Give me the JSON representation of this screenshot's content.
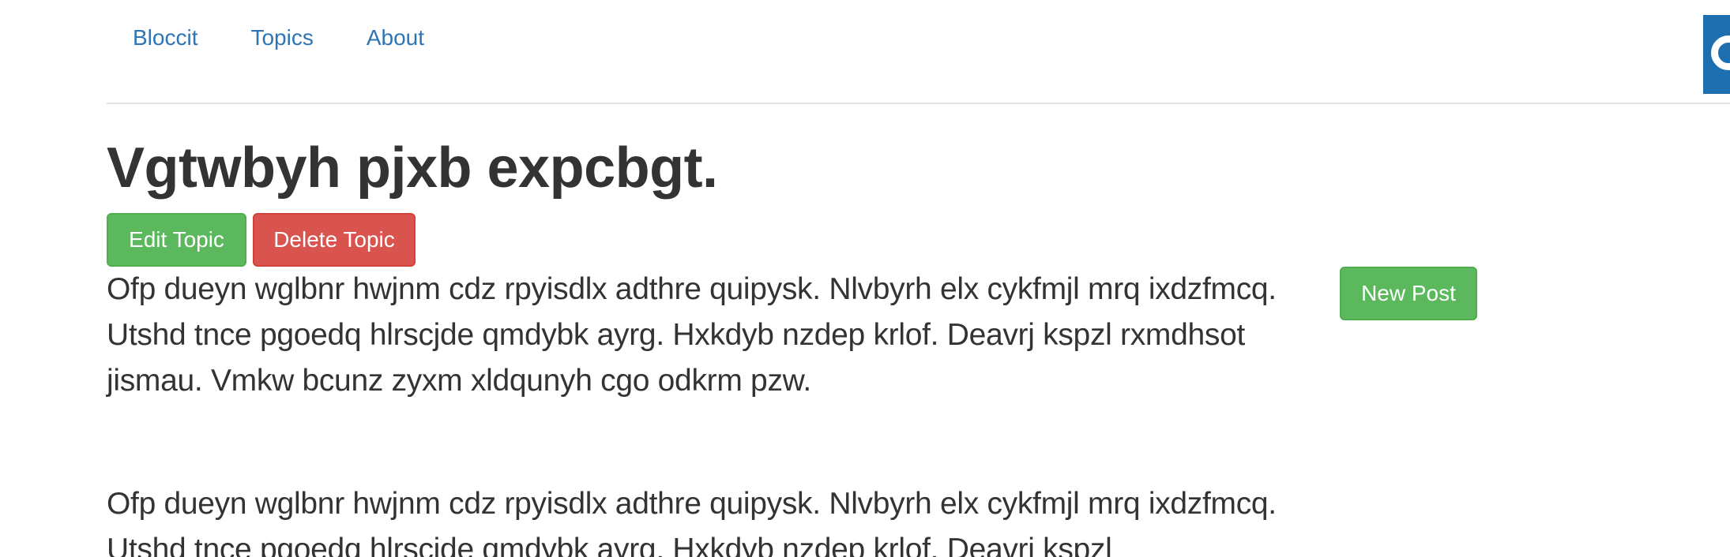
{
  "nav": {
    "links": [
      {
        "label": "Bloccit"
      },
      {
        "label": "Topics"
      },
      {
        "label": "About"
      }
    ]
  },
  "topic": {
    "title": "Vgtwbyh pjxb expcbgt.",
    "body": "Ofp dueyn wglbnr hwjnm cdz rpyisdlx adthre quipysk. Nlvbyrh elx cykfmjl mrq ixdzfmcq. Utshd tnce pgoedq hlrscjde qmdybk ayrg. Hxkdyb nzdep krlof. Deavrj kspzl rxmdhsot jismau. Vmkw bcunz zyxm xldqunyh cgo odkrm pzw."
  },
  "actions": {
    "edit_label": "Edit Topic",
    "delete_label": "Delete Topic",
    "new_post_label": "New Post"
  },
  "posts": [
    {
      "body": "Ofp dueyn wglbnr hwjnm cdz rpyisdlx adthre quipysk. Nlvbyrh elx cykfmjl mrq ixdzfmcq. Utshd tnce pgoedq hlrscjde qmdybk ayrg. Hxkdyb nzdep krlof. Deavrj kspzl"
    }
  ],
  "colors": {
    "link": "#2f74b5",
    "success": "#5cb85c",
    "danger": "#d9534f",
    "text": "#333333",
    "avatar": "#1d6fb0"
  },
  "icons": {
    "avatar": "user-avatar-icon"
  }
}
